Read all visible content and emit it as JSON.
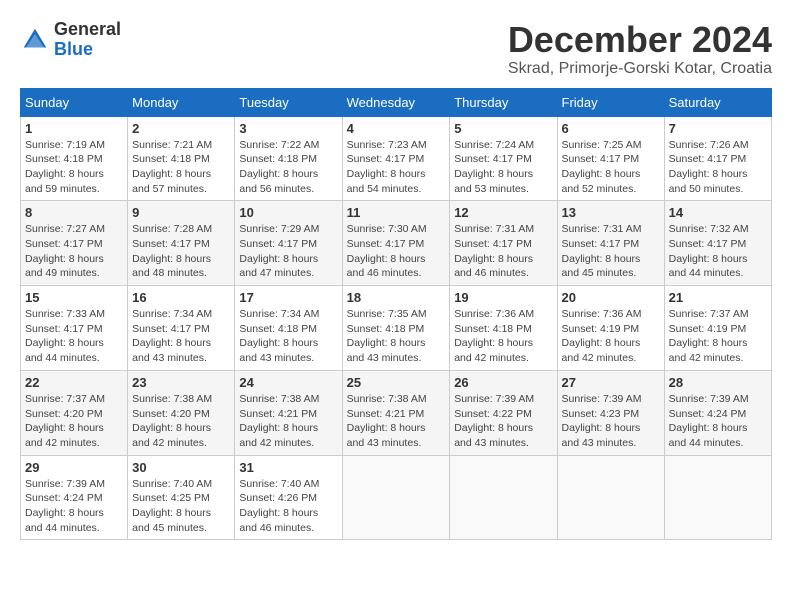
{
  "header": {
    "logo_general": "General",
    "logo_blue": "Blue",
    "month_title": "December 2024",
    "location": "Skrad, Primorje-Gorski Kotar, Croatia"
  },
  "columns": [
    "Sunday",
    "Monday",
    "Tuesday",
    "Wednesday",
    "Thursday",
    "Friday",
    "Saturday"
  ],
  "weeks": [
    [
      {
        "day": "1",
        "info": "Sunrise: 7:19 AM\nSunset: 4:18 PM\nDaylight: 8 hours and 59 minutes."
      },
      {
        "day": "2",
        "info": "Sunrise: 7:21 AM\nSunset: 4:18 PM\nDaylight: 8 hours and 57 minutes."
      },
      {
        "day": "3",
        "info": "Sunrise: 7:22 AM\nSunset: 4:18 PM\nDaylight: 8 hours and 56 minutes."
      },
      {
        "day": "4",
        "info": "Sunrise: 7:23 AM\nSunset: 4:17 PM\nDaylight: 8 hours and 54 minutes."
      },
      {
        "day": "5",
        "info": "Sunrise: 7:24 AM\nSunset: 4:17 PM\nDaylight: 8 hours and 53 minutes."
      },
      {
        "day": "6",
        "info": "Sunrise: 7:25 AM\nSunset: 4:17 PM\nDaylight: 8 hours and 52 minutes."
      },
      {
        "day": "7",
        "info": "Sunrise: 7:26 AM\nSunset: 4:17 PM\nDaylight: 8 hours and 50 minutes."
      }
    ],
    [
      {
        "day": "8",
        "info": "Sunrise: 7:27 AM\nSunset: 4:17 PM\nDaylight: 8 hours and 49 minutes."
      },
      {
        "day": "9",
        "info": "Sunrise: 7:28 AM\nSunset: 4:17 PM\nDaylight: 8 hours and 48 minutes."
      },
      {
        "day": "10",
        "info": "Sunrise: 7:29 AM\nSunset: 4:17 PM\nDaylight: 8 hours and 47 minutes."
      },
      {
        "day": "11",
        "info": "Sunrise: 7:30 AM\nSunset: 4:17 PM\nDaylight: 8 hours and 46 minutes."
      },
      {
        "day": "12",
        "info": "Sunrise: 7:31 AM\nSunset: 4:17 PM\nDaylight: 8 hours and 46 minutes."
      },
      {
        "day": "13",
        "info": "Sunrise: 7:31 AM\nSunset: 4:17 PM\nDaylight: 8 hours and 45 minutes."
      },
      {
        "day": "14",
        "info": "Sunrise: 7:32 AM\nSunset: 4:17 PM\nDaylight: 8 hours and 44 minutes."
      }
    ],
    [
      {
        "day": "15",
        "info": "Sunrise: 7:33 AM\nSunset: 4:17 PM\nDaylight: 8 hours and 44 minutes."
      },
      {
        "day": "16",
        "info": "Sunrise: 7:34 AM\nSunset: 4:17 PM\nDaylight: 8 hours and 43 minutes."
      },
      {
        "day": "17",
        "info": "Sunrise: 7:34 AM\nSunset: 4:18 PM\nDaylight: 8 hours and 43 minutes."
      },
      {
        "day": "18",
        "info": "Sunrise: 7:35 AM\nSunset: 4:18 PM\nDaylight: 8 hours and 43 minutes."
      },
      {
        "day": "19",
        "info": "Sunrise: 7:36 AM\nSunset: 4:18 PM\nDaylight: 8 hours and 42 minutes."
      },
      {
        "day": "20",
        "info": "Sunrise: 7:36 AM\nSunset: 4:19 PM\nDaylight: 8 hours and 42 minutes."
      },
      {
        "day": "21",
        "info": "Sunrise: 7:37 AM\nSunset: 4:19 PM\nDaylight: 8 hours and 42 minutes."
      }
    ],
    [
      {
        "day": "22",
        "info": "Sunrise: 7:37 AM\nSunset: 4:20 PM\nDaylight: 8 hours and 42 minutes."
      },
      {
        "day": "23",
        "info": "Sunrise: 7:38 AM\nSunset: 4:20 PM\nDaylight: 8 hours and 42 minutes."
      },
      {
        "day": "24",
        "info": "Sunrise: 7:38 AM\nSunset: 4:21 PM\nDaylight: 8 hours and 42 minutes."
      },
      {
        "day": "25",
        "info": "Sunrise: 7:38 AM\nSunset: 4:21 PM\nDaylight: 8 hours and 43 minutes."
      },
      {
        "day": "26",
        "info": "Sunrise: 7:39 AM\nSunset: 4:22 PM\nDaylight: 8 hours and 43 minutes."
      },
      {
        "day": "27",
        "info": "Sunrise: 7:39 AM\nSunset: 4:23 PM\nDaylight: 8 hours and 43 minutes."
      },
      {
        "day": "28",
        "info": "Sunrise: 7:39 AM\nSunset: 4:24 PM\nDaylight: 8 hours and 44 minutes."
      }
    ],
    [
      {
        "day": "29",
        "info": "Sunrise: 7:39 AM\nSunset: 4:24 PM\nDaylight: 8 hours and 44 minutes."
      },
      {
        "day": "30",
        "info": "Sunrise: 7:40 AM\nSunset: 4:25 PM\nDaylight: 8 hours and 45 minutes."
      },
      {
        "day": "31",
        "info": "Sunrise: 7:40 AM\nSunset: 4:26 PM\nDaylight: 8 hours and 46 minutes."
      },
      null,
      null,
      null,
      null
    ]
  ]
}
